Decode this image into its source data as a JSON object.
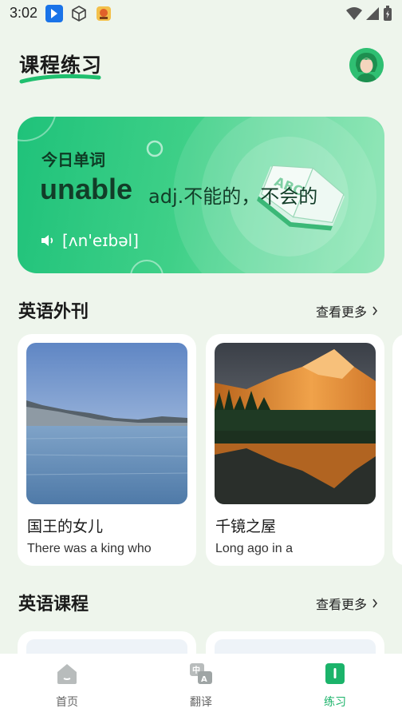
{
  "status_bar": {
    "time": "3:02"
  },
  "header": {
    "title": "课程练习"
  },
  "word_card": {
    "label": "今日单词",
    "word": "unable",
    "meaning": "adj.不能的，不会的",
    "phonetic": "[ʌn'eɪbəl]",
    "colors": {
      "start": "#1fc27a",
      "end": "#8ae5b3"
    }
  },
  "magazine": {
    "title": "英语外刊",
    "more": "查看更多",
    "articles": [
      {
        "title": "国王的女儿",
        "subtitle": "There was a king who",
        "image": "lake-landscape"
      },
      {
        "title": "千镜之屋",
        "subtitle": "Long ago in a",
        "image": "mountain-reflection"
      }
    ]
  },
  "courses": {
    "title": "英语课程",
    "more": "查看更多"
  },
  "nav": {
    "items": [
      {
        "label": "首页",
        "icon": "home-icon"
      },
      {
        "label": "翻译",
        "icon": "translate-icon"
      },
      {
        "label": "练习",
        "icon": "practice-icon"
      }
    ],
    "active_color": "#1bb36a"
  }
}
